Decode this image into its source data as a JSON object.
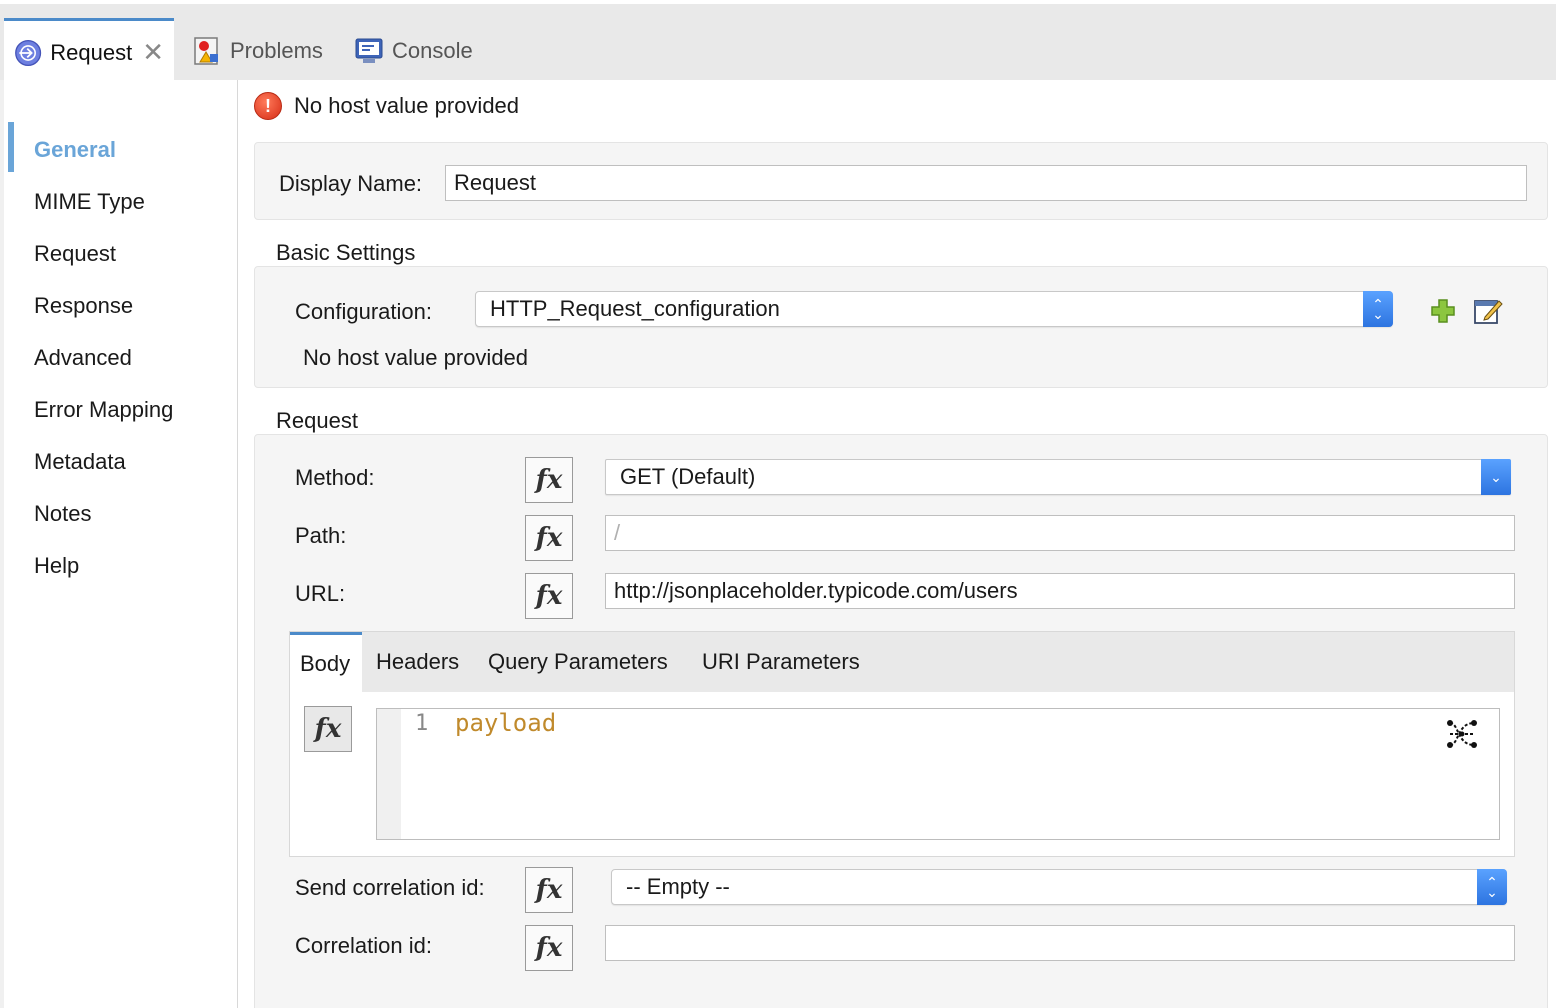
{
  "tabs": [
    {
      "label": "Request",
      "active": true,
      "closable": true
    },
    {
      "label": "Problems"
    },
    {
      "label": "Console"
    }
  ],
  "nav": {
    "items": [
      "General",
      "MIME Type",
      "Request",
      "Response",
      "Advanced",
      "Error Mapping",
      "Metadata",
      "Notes",
      "Help"
    ],
    "active": "General"
  },
  "error": {
    "message": "No host value provided"
  },
  "general": {
    "display_name_label": "Display Name:",
    "display_name_value": "Request"
  },
  "basic": {
    "title": "Basic Settings",
    "configuration_label": "Configuration:",
    "configuration_value": "HTTP_Request_configuration",
    "config_message": "No host value provided"
  },
  "request": {
    "title": "Request",
    "method_label": "Method:",
    "method_value": "GET (Default)",
    "path_label": "Path:",
    "path_placeholder": "/",
    "url_label": "URL:",
    "url_value": "http://jsonplaceholder.typicode.com/users",
    "subtabs": [
      "Body",
      "Headers",
      "Query Parameters",
      "URI Parameters"
    ],
    "body": {
      "line_number": "1",
      "code": "payload"
    },
    "send_correlation_label": "Send correlation id:",
    "send_correlation_value": "-- Empty --",
    "correlation_label": "Correlation id:",
    "correlation_value": ""
  },
  "fx_label": "fx",
  "colors": {
    "accent": "#4b8ac9",
    "nav_active": "#6aa5d8",
    "error": "#d62d16",
    "code": "#c08a2c"
  }
}
